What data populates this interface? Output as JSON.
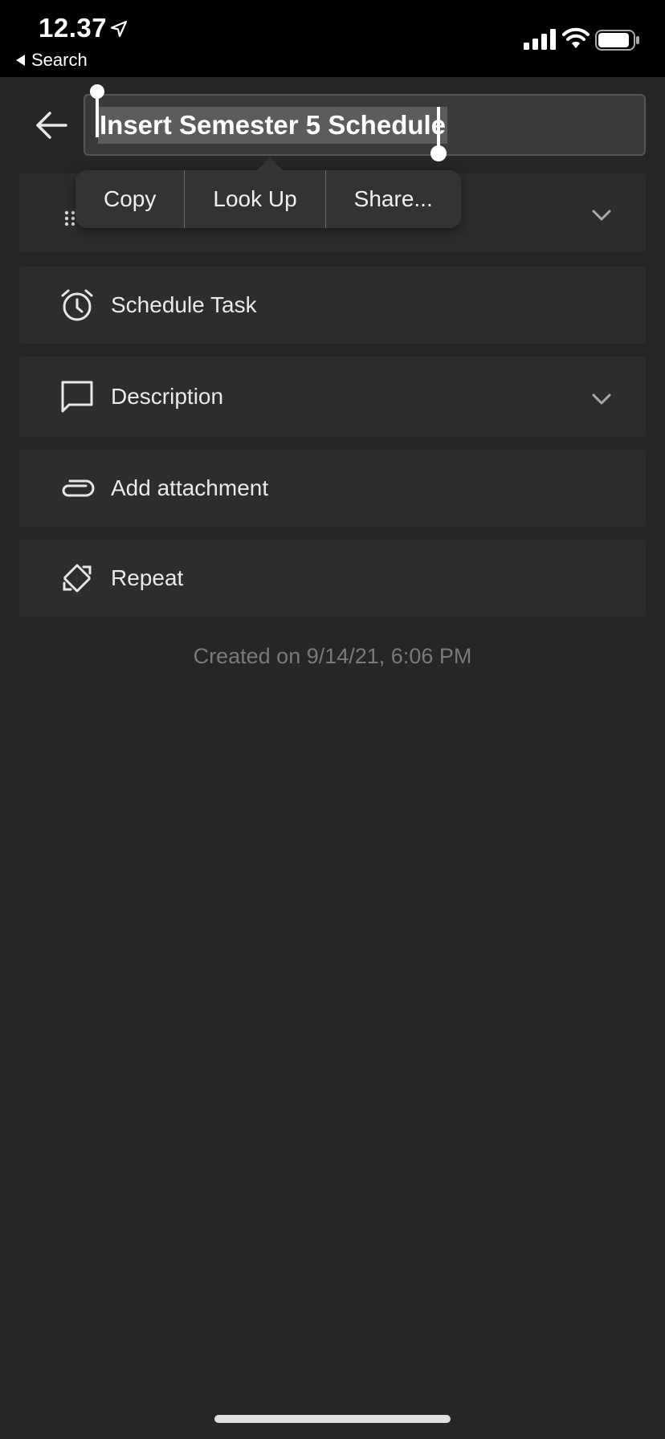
{
  "status_bar": {
    "time": "12.37",
    "back_label": "Search",
    "icons": [
      "location-arrow-icon",
      "cellular-signal-icon",
      "wifi-icon",
      "battery-icon"
    ]
  },
  "header": {
    "back_icon": "back-arrow-icon",
    "title_value": "Insert Semester 5 Schedule"
  },
  "context_menu": {
    "items": [
      "Copy",
      "Look Up",
      "Share..."
    ]
  },
  "rows": [
    {
      "icon": "drag-handle-icon",
      "label": "",
      "has_chevron": true
    },
    {
      "icon": "alarm-clock-icon",
      "label": "Schedule Task",
      "has_chevron": false
    },
    {
      "icon": "comment-icon",
      "label": "Description",
      "has_chevron": true
    },
    {
      "icon": "paperclip-icon",
      "label": "Add attachment",
      "has_chevron": false
    },
    {
      "icon": "repeat-icon",
      "label": "Repeat",
      "has_chevron": false
    }
  ],
  "footer": {
    "created_text": "Created on 9/14/21, 6:06 PM"
  },
  "colors": {
    "background": "#262626",
    "row_background": "#2d2d2d",
    "status_bar": "#000000",
    "muted_text": "#7a7a7a"
  }
}
